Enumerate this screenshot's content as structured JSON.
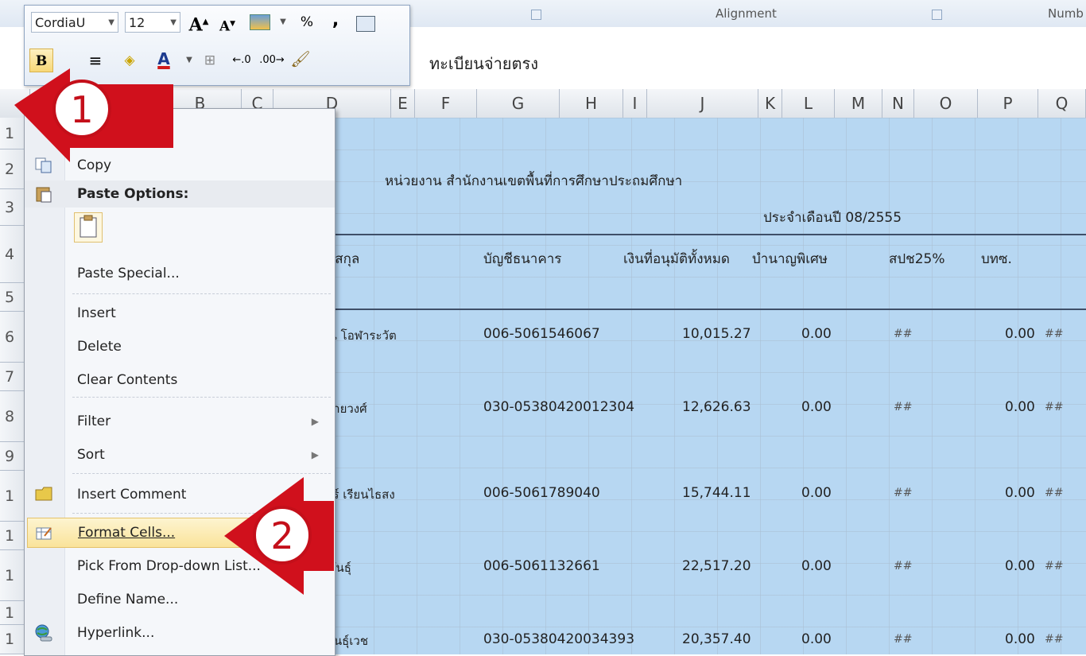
{
  "ribbon": {
    "group_alignment": "Alignment",
    "group_number": "Numb"
  },
  "mini_toolbar": {
    "font_name": "CordiaU",
    "font_size": "12",
    "percent": "%",
    "comma": ","
  },
  "formula_bar": {
    "value": "ทะเบียนจ่ายตรง"
  },
  "column_headers": [
    "B",
    "C",
    "D",
    "E",
    "F",
    "G",
    "H",
    "I",
    "J",
    "K",
    "L",
    "M",
    "N",
    "O",
    "P",
    "Q"
  ],
  "row_headers": [
    "1",
    "2",
    "3",
    "4",
    "5",
    "6",
    "7",
    "8",
    "9",
    "1",
    "1",
    "1",
    "1",
    "1"
  ],
  "sheet": {
    "agency": "หน่วยงาน สำนักงานเขตพื้นที่การศึกษาประถมศึกษา",
    "period": "ประจำเดือนปี 08/2555",
    "headers": {
      "name": "มสกุล",
      "bank_account": "บัญชีธนาคาร",
      "total_approved": "เงินที่อนุมัติทั้งหมด",
      "special_pension": "บำนาญพิเศษ",
      "spc25": "สปช25%",
      "bts": "บทซ."
    },
    "rows": [
      {
        "name": "ณ โอฬาระวัต",
        "account": "006-5061546067",
        "amount": "10,015.27",
        "special": "0.00",
        "n": "##",
        "p": "0.00",
        "q": "##"
      },
      {
        "name": "สายวงศ์",
        "account": "030-05380420012304",
        "amount": "12,626.63",
        "special": "0.00",
        "n": "##",
        "p": "0.00",
        "q": "##"
      },
      {
        "name": "าร์ เรียนไธสง",
        "account": "006-5061789040",
        "amount": "15,744.11",
        "special": "0.00",
        "n": "##",
        "p": "0.00",
        "q": "##"
      },
      {
        "name": "ฑันธุ์",
        "account": "006-5061132661",
        "amount": "22,517.20",
        "special": "0.00",
        "n": "##",
        "p": "0.00",
        "q": "##"
      },
      {
        "name": "พันธุ์เวช",
        "account": "030-05380420034393",
        "amount": "20,357.40",
        "special": "0.00",
        "n": "##",
        "p": "0.00",
        "q": "##"
      }
    ]
  },
  "context_menu": {
    "copy": "Copy",
    "paste_options": "Paste Options:",
    "paste_special": "Paste Special...",
    "insert": "Insert",
    "delete": "Delete",
    "clear_contents": "Clear Contents",
    "filter": "Filter",
    "sort": "Sort",
    "insert_comment": "Insert Comment",
    "format_cells": "Format Cells...",
    "pick_from_dropdown": "Pick From Drop-down List...",
    "define_name": "Define Name...",
    "hyperlink": "Hyperlink..."
  },
  "callouts": {
    "step1": "1",
    "step2": "2",
    "color": "#d0101c"
  }
}
